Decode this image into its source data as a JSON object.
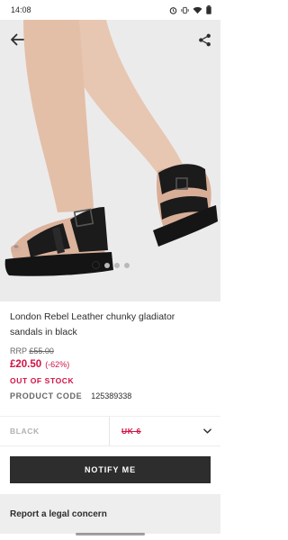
{
  "status_bar": {
    "time": "14:08"
  },
  "gallery": {
    "image_count": 4,
    "active_index": 0
  },
  "product": {
    "title": "London Rebel Leather chunky gladiator sandals in black",
    "rrp_label": "RRP",
    "rrp_price": "£55.00",
    "price": "£20.50",
    "discount": "(-62%)",
    "stock_status": "OUT OF STOCK",
    "code_label": "PRODUCT CODE",
    "code_value": "125389338"
  },
  "options": {
    "colour": "BLACK",
    "size": "UK 6"
  },
  "actions": {
    "notify_label": "NOTIFY ME"
  },
  "footer": {
    "legal_label": "Report a legal concern"
  },
  "colors": {
    "sale": "#d01345",
    "button": "#2d2d2d",
    "legal_bg": "#eeeeee"
  }
}
